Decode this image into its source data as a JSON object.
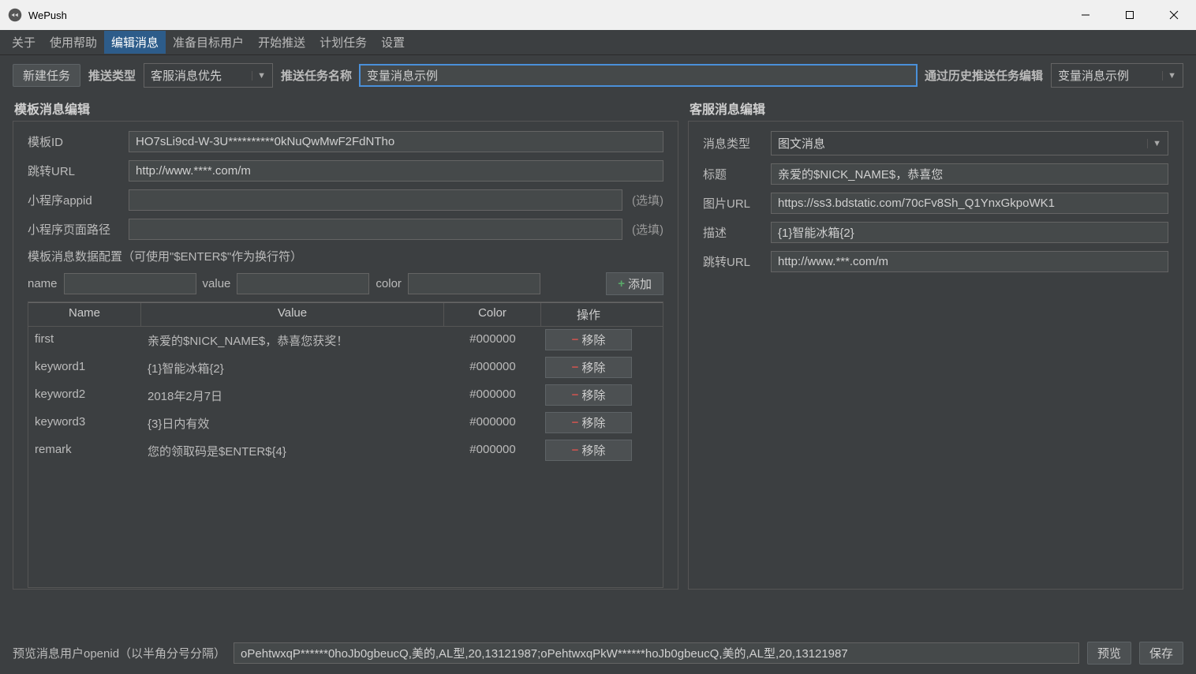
{
  "window": {
    "title": "WePush"
  },
  "menu": {
    "items": [
      "关于",
      "使用帮助",
      "编辑消息",
      "准备目标用户",
      "开始推送",
      "计划任务",
      "设置"
    ],
    "active_index": 2
  },
  "toolbar": {
    "new_task": "新建任务",
    "push_type_label": "推送类型",
    "push_type_value": "客服消息优先",
    "task_name_label": "推送任务名称",
    "task_name_value": "变量消息示例",
    "history_label": "通过历史推送任务编辑",
    "history_value": "变量消息示例"
  },
  "template_panel": {
    "title": "模板消息编辑",
    "labels": {
      "template_id": "模板ID",
      "jump_url": "跳转URL",
      "mini_appid": "小程序appid",
      "mini_path": "小程序页面路径",
      "optional": "(选填)"
    },
    "template_id": "HO7sLi9cd-W-3U**********0kNuQwMwF2FdNTho",
    "jump_url": "http://www.****.com/m",
    "mini_appid": "",
    "mini_path": "",
    "data_config_title": "模板消息数据配置（可使用\"$ENTER$\"作为换行符）",
    "add_row": {
      "name_label": "name",
      "value_label": "value",
      "color_label": "color",
      "add_btn": "添加"
    },
    "columns": {
      "name": "Name",
      "value": "Value",
      "color": "Color",
      "op": "操作"
    },
    "remove_label": "移除",
    "rows": [
      {
        "name": "first",
        "value": "亲爱的$NICK_NAME$，恭喜您获奖！",
        "color": "#000000"
      },
      {
        "name": "keyword1",
        "value": "{1}智能冰箱{2}",
        "color": "#000000"
      },
      {
        "name": "keyword2",
        "value": "2018年2月7日",
        "color": "#000000"
      },
      {
        "name": "keyword3",
        "value": "{3}日内有效",
        "color": "#000000"
      },
      {
        "name": "remark",
        "value": "您的领取码是$ENTER${4}",
        "color": "#000000"
      }
    ]
  },
  "kefu_panel": {
    "title": "客服消息编辑",
    "labels": {
      "msg_type": "消息类型",
      "title": "标题",
      "pic_url": "图片URL",
      "desc": "描述",
      "jump_url": "跳转URL"
    },
    "msg_type": "图文消息",
    "title_value": "亲爱的$NICK_NAME$，恭喜您",
    "pic_url": "https://ss3.bdstatic.com/70cFv8Sh_Q1YnxGkpoWK1",
    "desc": "{1}智能冰箱{2}",
    "jump_url": "http://www.***.com/m"
  },
  "footer": {
    "preview_label": "预览消息用户openid（以半角分号分隔）",
    "preview_value": "oPehtwxqP******0hoJb0gbeucQ,美的,AL型,20,13121987;oPehtwxqPkW******hoJb0gbeucQ,美的,AL型,20,13121987",
    "preview_btn": "预览",
    "save_btn": "保存"
  }
}
